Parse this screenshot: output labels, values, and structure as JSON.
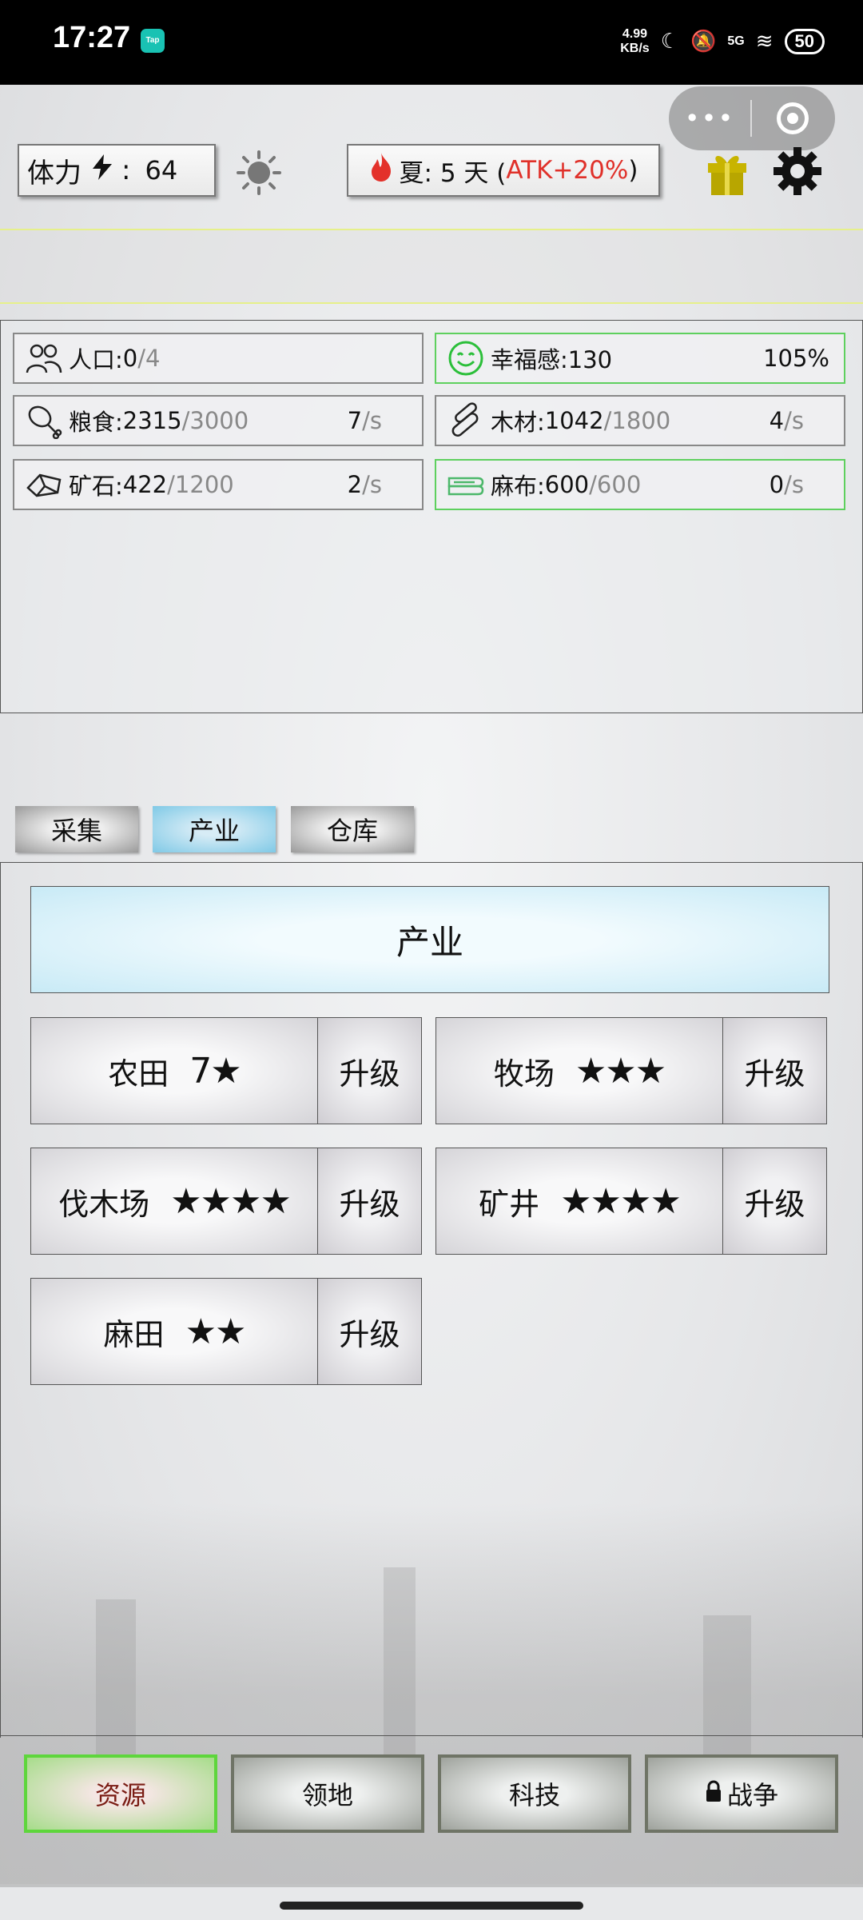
{
  "status_bar": {
    "time": "17:27",
    "app_badge": "Tap",
    "net_speed_top": "4.99",
    "net_speed_bottom": "KB/s",
    "signal": "5G",
    "battery": "50"
  },
  "top": {
    "stamina_label": "体力",
    "stamina_sep": ":",
    "stamina_value": "64",
    "season_label": "夏: 5 天 (",
    "season_atk": "ATK+20%",
    "season_close": ")"
  },
  "resources": [
    {
      "label": "人口:",
      "current": "0",
      "max": "/4",
      "rate": "",
      "unit": "",
      "pct": "",
      "icon": "people-icon"
    },
    {
      "label": "幸福感:130",
      "current": "",
      "max": "",
      "rate": "",
      "unit": "",
      "pct": "105%",
      "icon": "smile-icon"
    },
    {
      "label": "粮食:",
      "current": "2315",
      "max": "/3000",
      "rate": "7",
      "unit": "/s",
      "pct": "",
      "icon": "meat-icon"
    },
    {
      "label": "木材:",
      "current": "1042",
      "max": "/1800",
      "rate": "4",
      "unit": "/s",
      "pct": "",
      "icon": "wood-icon"
    },
    {
      "label": "矿石:",
      "current": "422",
      "max": "/1200",
      "rate": "2",
      "unit": "/s",
      "pct": "",
      "icon": "ore-icon"
    },
    {
      "label": "麻布:",
      "current": "600",
      "max": "/600",
      "rate": "0",
      "unit": "/s",
      "pct": "",
      "icon": "cloth-icon"
    }
  ],
  "tabs": [
    "采集",
    "产业",
    "仓库"
  ],
  "section_title": "产业",
  "industries": [
    {
      "name": "农田",
      "stars": "7★",
      "action": "升级"
    },
    {
      "name": "牧场",
      "stars": "★★★",
      "action": "升级"
    },
    {
      "name": "伐木场",
      "stars": "★★★★",
      "action": "升级"
    },
    {
      "name": "矿井",
      "stars": "★★★★",
      "action": "升级"
    },
    {
      "name": "麻田",
      "stars": "★★",
      "action": "升级"
    }
  ],
  "bottom_nav": [
    "资源",
    "领地",
    "科技",
    "战争"
  ],
  "colors": {
    "accent_green": "#5ed63c",
    "atk_red": "#e0312a",
    "active_tab": "#7fc9e6"
  }
}
